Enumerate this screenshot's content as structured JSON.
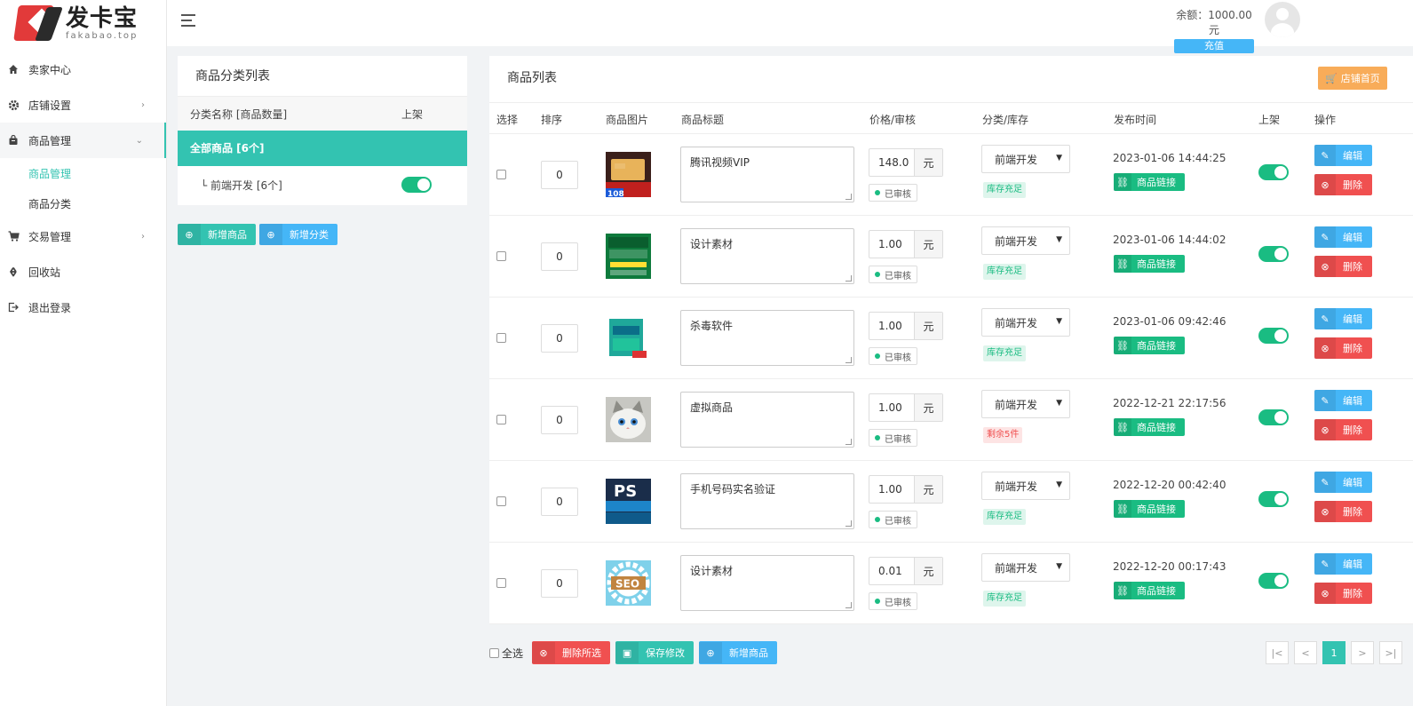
{
  "brand": {
    "name_cn": "发卡宝",
    "name_en": "fakabao.top"
  },
  "header": {
    "balance": "余额：1000.00元",
    "recharge": "充值"
  },
  "sidebar": {
    "items": [
      {
        "label": "卖家中心",
        "icon": "home-icon"
      },
      {
        "label": "店铺设置",
        "icon": "gear-icon"
      },
      {
        "label": "商品管理",
        "icon": "bag-icon"
      },
      {
        "label": "交易管理",
        "icon": "cart-icon"
      },
      {
        "label": "回收站",
        "icon": "recycle-icon"
      },
      {
        "label": "退出登录",
        "icon": "logout-icon"
      }
    ],
    "sub_items": [
      "商品管理",
      "商品分类"
    ]
  },
  "category_panel": {
    "title": "商品分类列表",
    "col_name": "分类名称 [商品数量]",
    "col_on": "上架",
    "all": "全部商品 [6个]",
    "rows": [
      {
        "label": "└ 前端开发 [6个]"
      }
    ],
    "btn_add_goods": "新增商品",
    "btn_add_cat": "新增分类"
  },
  "goods_panel": {
    "title": "商品列表",
    "shop_home": "店铺首页",
    "columns": [
      "选择",
      "排序",
      "商品图片",
      "商品标题",
      "价格/审核",
      "分类/库存",
      "发布时间",
      "上架",
      "操作"
    ],
    "currency": "元",
    "audit": "已审核",
    "link_label": "商品链接",
    "edit_label": "编辑",
    "delete_label": "删除",
    "rows": [
      {
        "sort": "0",
        "title": "腾讯视频VIP",
        "price": "148.0",
        "category": "前端开发",
        "stock": "库存充足",
        "stock_status": "ok",
        "time": "2023-01-06 14:44:25",
        "img": "vip"
      },
      {
        "sort": "0",
        "title": "设计素材",
        "price": "1.00",
        "category": "前端开发",
        "stock": "库存充足",
        "stock_status": "ok",
        "time": "2023-01-06 14:44:02",
        "img": "font"
      },
      {
        "sort": "0",
        "title": "杀毒软件",
        "price": "1.00",
        "category": "前端开发",
        "stock": "库存充足",
        "stock_status": "ok",
        "time": "2023-01-06 09:42:46",
        "img": "box"
      },
      {
        "sort": "0",
        "title": "虚拟商品",
        "price": "1.00",
        "category": "前端开发",
        "stock": "剩余5件",
        "stock_status": "low",
        "time": "2022-12-21 22:17:56",
        "img": "cat"
      },
      {
        "sort": "0",
        "title": "手机号码实名验证",
        "price": "1.00",
        "category": "前端开发",
        "stock": "库存充足",
        "stock_status": "ok",
        "time": "2022-12-20 00:42:40",
        "img": "ps"
      },
      {
        "sort": "0",
        "title": "设计素材",
        "price": "0.01",
        "category": "前端开发",
        "stock": "库存充足",
        "stock_status": "ok",
        "time": "2022-12-20 00:17:43",
        "img": "seo"
      }
    ]
  },
  "bottom": {
    "select_all": "全选",
    "delete_selected": "删除所选",
    "save": "保存修改",
    "add_goods": "新增商品"
  },
  "pager": {
    "first": "|<",
    "prev": "<",
    "current": "1",
    "next": ">",
    "last": ">|"
  }
}
